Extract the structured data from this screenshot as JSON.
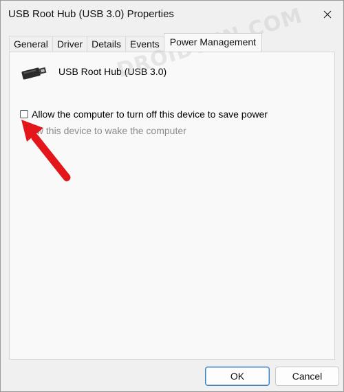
{
  "window": {
    "title": "USB Root Hub (USB 3.0) Properties"
  },
  "tabs": [
    {
      "label": "General"
    },
    {
      "label": "Driver"
    },
    {
      "label": "Details"
    },
    {
      "label": "Events"
    },
    {
      "label": "Power Management",
      "selected": true
    }
  ],
  "device": {
    "name": "USB Root Hub (USB 3.0)",
    "icon": "usb-connector-icon"
  },
  "options": {
    "allow_turn_off": {
      "label": "Allow the computer to turn off this device to save power",
      "checked": false
    },
    "allow_wake": {
      "label": "Allow this device to wake the computer",
      "visible_text": "low this device to wake the computer",
      "enabled": false
    }
  },
  "watermark": "DROIDWIN.COM",
  "buttons": {
    "ok": "OK",
    "cancel": "Cancel"
  },
  "colors": {
    "arrow": "#e3161b",
    "focus_border": "#3b82c4"
  }
}
